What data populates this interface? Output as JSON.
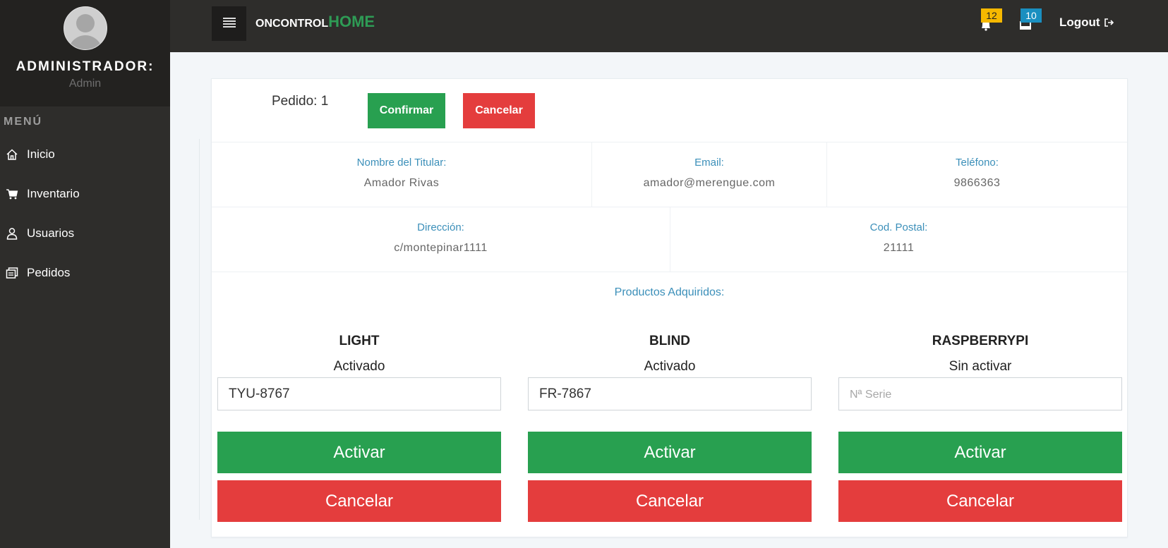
{
  "sidebar": {
    "role": "ADMINISTRADOR:",
    "user": "Admin",
    "menu_title": "MENÚ",
    "items": [
      {
        "label": "Inicio",
        "icon": "home-icon"
      },
      {
        "label": "Inventario",
        "icon": "cart-icon"
      },
      {
        "label": "Usuarios",
        "icon": "user-icon"
      },
      {
        "label": "Pedidos",
        "icon": "orders-icon"
      }
    ]
  },
  "topbar": {
    "brand_prefix": "ONCONTROL",
    "brand_highlight": "HOME",
    "notifications_count": "12",
    "messages_count": "10",
    "logout_label": "Logout",
    "colors": {
      "notif_badge": "#f6b800",
      "msg_badge": "#1a8fc0",
      "brand_highlight": "#2e9b55"
    }
  },
  "order": {
    "title": "Pedido: 1",
    "confirm_label": "Confirmar",
    "cancel_label": "Cancelar",
    "holder_label": "Nombre del Titular:",
    "holder_value": "Amador Rivas",
    "email_label": "Email:",
    "email_value": "amador@merengue.com",
    "phone_label": "Teléfono:",
    "phone_value": "9866363",
    "address_label": "Dirección:",
    "address_value": "c/montepinar1111",
    "postal_label": "Cod. Postal:",
    "postal_value": "21111",
    "products_title": "Productos Adquiridos:"
  },
  "products": [
    {
      "name": "LIGHT",
      "status": "Activado",
      "serial_value": "TYU-8767",
      "serial_placeholder": "Nª Serie",
      "activate_label": "Activar",
      "cancel_label": "Cancelar"
    },
    {
      "name": "BLIND",
      "status": "Activado",
      "serial_value": "FR-7867",
      "serial_placeholder": "Nª Serie",
      "activate_label": "Activar",
      "cancel_label": "Cancelar"
    },
    {
      "name": "RASPBERRYPI",
      "status": "Sin activar",
      "serial_value": "",
      "serial_placeholder": "Nª Serie",
      "activate_label": "Activar",
      "cancel_label": "Cancelar"
    }
  ],
  "colors": {
    "success": "#28a050",
    "danger": "#e43d3d",
    "accent_label": "#3b8fb9",
    "sidebar_bg": "#2e2d2b"
  }
}
